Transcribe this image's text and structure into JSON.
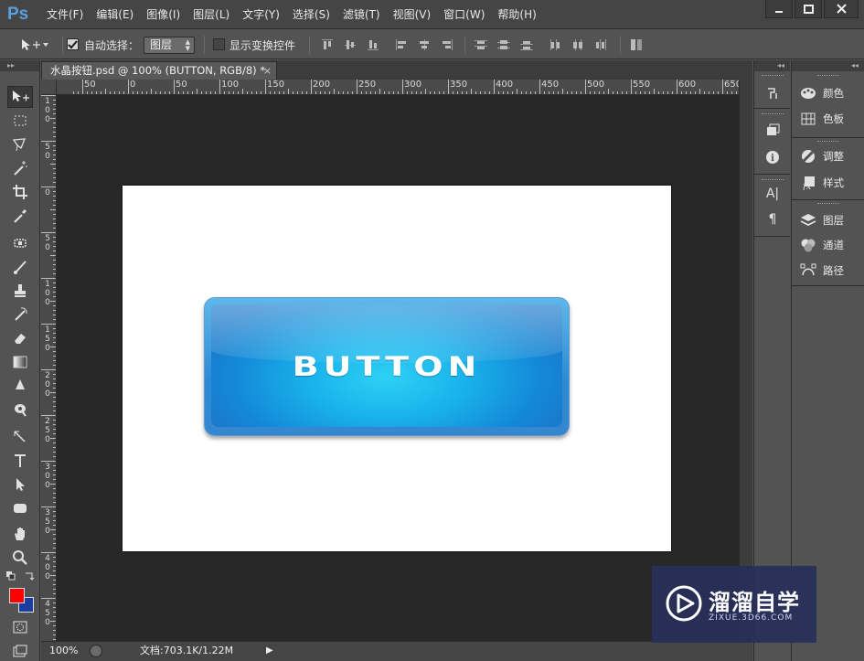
{
  "app": {
    "logo_text": "Ps"
  },
  "menu": {
    "items": [
      "文件(F)",
      "编辑(E)",
      "图像(I)",
      "图层(L)",
      "文字(Y)",
      "选择(S)",
      "滤镜(T)",
      "视图(V)",
      "窗口(W)",
      "帮助(H)"
    ]
  },
  "options": {
    "auto_select_label": "自动选择：",
    "auto_select_checked": true,
    "auto_select_target": "图层",
    "show_transform_label": "显示变换控件",
    "show_transform_checked": false
  },
  "document": {
    "tab_title": "水晶按钮.psd @ 100% (BUTTON, RGB/8) *",
    "tab_close": "×",
    "button_text": "BUTTON",
    "button_colors": {
      "top": "#5eb8ea",
      "center": "#2ed1f4",
      "edge": "#1a7acb"
    }
  },
  "rulers": {
    "horizontal": [
      "50",
      "0",
      "50",
      "100",
      "150",
      "200",
      "250",
      "300",
      "350",
      "400",
      "450",
      "500",
      "550",
      "600",
      "650"
    ],
    "vertical": [
      "100",
      "50",
      "0",
      "50",
      "100",
      "150",
      "200",
      "250",
      "300",
      "350",
      "400",
      "450"
    ]
  },
  "status": {
    "zoom": "100%",
    "doc_info": "文档:703.1K/1.22M",
    "arrow": "▶"
  },
  "colors": {
    "foreground": "#ff0000",
    "background": "#1a3d9e"
  },
  "dock_arrows": {
    "left": "▸▸",
    "right": "◂◂"
  },
  "panels": {
    "narrow_icons": [
      "history-icon",
      "layer-comps-icon",
      "info-icon",
      "character-icon",
      "paragraph-icon"
    ],
    "character_glyph": "A|",
    "paragraph_glyph": "¶",
    "info_glyph": "i",
    "items": [
      {
        "label": "颜色",
        "icon": "palette-icon"
      },
      {
        "label": "色板",
        "icon": "swatches-icon"
      },
      {
        "label": "调整",
        "icon": "adjustments-icon"
      },
      {
        "label": "样式",
        "icon": "styles-icon"
      },
      {
        "label": "图层",
        "icon": "layers-icon"
      },
      {
        "label": "通道",
        "icon": "channels-icon"
      },
      {
        "label": "路径",
        "icon": "paths-icon"
      }
    ]
  },
  "watermark": {
    "title": "溜溜自学",
    "subtitle": "ZIXUE.3D66.COM"
  }
}
